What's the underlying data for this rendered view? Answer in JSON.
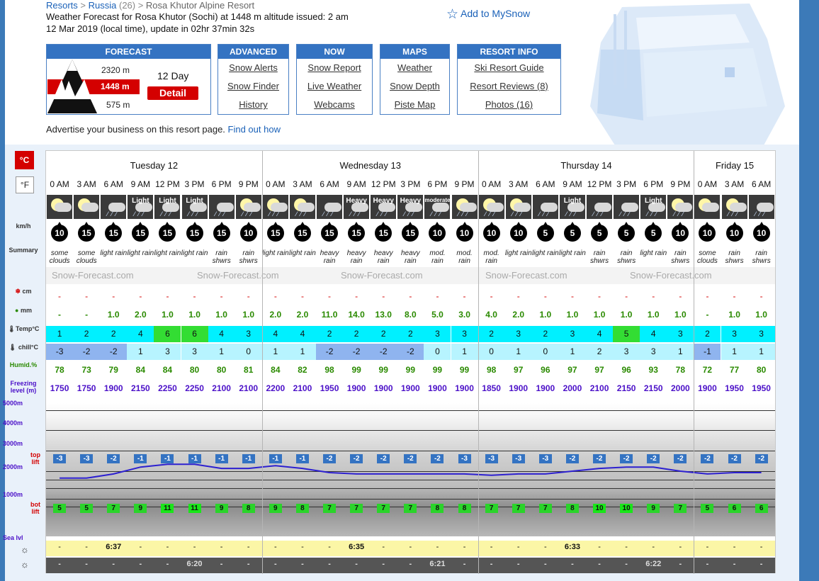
{
  "breadcrumb": {
    "resorts": "Resorts",
    "sep1": " > ",
    "country": "Russia",
    "count": " (26) > ",
    "current": "Rosa Khutor Alpine Resort"
  },
  "title": "Weather Forecast for Rosa Khutor (Sochi) at 1448 m altitude issued: 2 am\n 12 Mar 2019 (local time), update in 02hr 37min 32s",
  "mysnow": "Add to MySnow",
  "forecast_box": {
    "header": "FORECAST",
    "top_alt": "2320 m",
    "cur_alt": "1448 m",
    "bot_alt": "575 m",
    "days": "12 Day",
    "detail": "Detail"
  },
  "menus": [
    {
      "header": "ADVANCED",
      "items": [
        "Snow Alerts",
        "Snow Finder",
        "History"
      ]
    },
    {
      "header": "NOW",
      "items": [
        "Snow Report",
        "Live Weather",
        "Webcams"
      ]
    },
    {
      "header": "MAPS",
      "items": [
        "Weather",
        "Snow Depth",
        "Piste Map"
      ]
    },
    {
      "header": "RESORT INFO",
      "items": [
        "Ski Resort Guide",
        "Resort Reviews (8)",
        "Photos (16)"
      ]
    }
  ],
  "advert": {
    "text": "Advertise your business on this resort page. ",
    "link": "Find out how"
  },
  "units": {
    "c": "°C",
    "f": "°F"
  },
  "row_labels": {
    "wind": "km/h",
    "summary": "Summary",
    "snow": "cm",
    "rain": "mm",
    "temp": "Temp°C",
    "chill": "chill°C",
    "humid": "Humid.%",
    "freeze": "Freezing level (m)",
    "alt5000": "5000m",
    "alt4000": "4000m",
    "alt3000": "3000m",
    "top": "top",
    "lift": "lift",
    "alt2000": "2000m",
    "alt1000": "1000m",
    "bot": "bot",
    "lift2": "lift",
    "sealvl": "Sea lvl"
  },
  "watermark": "Snow-Forecast.com",
  "days": [
    {
      "name": "Tuesday 12",
      "n": 8
    },
    {
      "name": "Wednesday 13",
      "n": 8
    },
    {
      "name": "Thursday 14",
      "n": 8
    },
    {
      "name": "Friday 15",
      "n": 3
    }
  ],
  "columns": [
    {
      "time": "0 AM",
      "wx": "",
      "wind": "10",
      "summary": "some clouds",
      "snow": "-",
      "rain": "-",
      "temp": "1",
      "chill": "-3",
      "humid": "78",
      "freeze": "1750",
      "top": "-3",
      "bot": "5",
      "rise": "-",
      "set": "-"
    },
    {
      "time": "3 AM",
      "wx": "",
      "wind": "15",
      "summary": "some clouds",
      "snow": "-",
      "rain": "-",
      "temp": "2",
      "chill": "-2",
      "humid": "73",
      "freeze": "1750",
      "top": "-3",
      "bot": "5",
      "rise": "-",
      "set": "-"
    },
    {
      "time": "6 AM",
      "wx": "",
      "wind": "15",
      "summary": "light rain",
      "snow": "-",
      "rain": "1.0",
      "temp": "2",
      "chill": "-2",
      "humid": "79",
      "freeze": "1900",
      "top": "-2",
      "bot": "7",
      "rise": "6:37",
      "set": "-"
    },
    {
      "time": "9 AM",
      "wx": "Light",
      "wind": "15",
      "summary": "light rain",
      "snow": "-",
      "rain": "2.0",
      "temp": "4",
      "chill": "1",
      "humid": "84",
      "freeze": "2150",
      "top": "-1",
      "bot": "9",
      "rise": "-",
      "set": "-"
    },
    {
      "time": "12 PM",
      "wx": "Light",
      "wind": "15",
      "summary": "light rain",
      "snow": "-",
      "rain": "1.0",
      "temp": "6",
      "chill": "3",
      "humid": "84",
      "freeze": "2250",
      "top": "-1",
      "bot": "11",
      "rise": "-",
      "set": "-"
    },
    {
      "time": "3 PM",
      "wx": "Light",
      "wind": "15",
      "summary": "light rain",
      "snow": "-",
      "rain": "1.0",
      "temp": "6",
      "chill": "3",
      "humid": "80",
      "freeze": "2250",
      "top": "-1",
      "bot": "11",
      "rise": "-",
      "set": "6:20"
    },
    {
      "time": "6 PM",
      "wx": "",
      "wind": "15",
      "summary": "rain shwrs",
      "snow": "-",
      "rain": "1.0",
      "temp": "4",
      "chill": "1",
      "humid": "80",
      "freeze": "2100",
      "top": "-1",
      "bot": "9",
      "rise": "-",
      "set": "-"
    },
    {
      "time": "9 PM",
      "wx": "",
      "wind": "10",
      "summary": "rain shwrs",
      "snow": "-",
      "rain": "1.0",
      "temp": "3",
      "chill": "0",
      "humid": "81",
      "freeze": "2100",
      "top": "-1",
      "bot": "8",
      "rise": "-",
      "set": "-"
    },
    {
      "time": "0 AM",
      "wx": "",
      "wind": "15",
      "summary": "light rain",
      "snow": "-",
      "rain": "2.0",
      "temp": "4",
      "chill": "1",
      "humid": "84",
      "freeze": "2200",
      "top": "-1",
      "bot": "9",
      "rise": "-",
      "set": "-"
    },
    {
      "time": "3 AM",
      "wx": "",
      "wind": "15",
      "summary": "light rain",
      "snow": "-",
      "rain": "2.0",
      "temp": "4",
      "chill": "1",
      "humid": "82",
      "freeze": "2100",
      "top": "-1",
      "bot": "8",
      "rise": "-",
      "set": "-"
    },
    {
      "time": "6 AM",
      "wx": "",
      "wind": "15",
      "summary": "heavy rain",
      "snow": "-",
      "rain": "11.0",
      "temp": "2",
      "chill": "-2",
      "humid": "98",
      "freeze": "1950",
      "top": "-2",
      "bot": "7",
      "rise": "-",
      "set": "-"
    },
    {
      "time": "9 AM",
      "wx": "Heavy",
      "wind": "15",
      "summary": "heavy rain",
      "snow": "-",
      "rain": "14.0",
      "temp": "2",
      "chill": "-2",
      "humid": "99",
      "freeze": "1900",
      "top": "-2",
      "bot": "7",
      "rise": "6:35",
      "set": "-"
    },
    {
      "time": "12 PM",
      "wx": "Heavy",
      "wind": "15",
      "summary": "heavy rain",
      "snow": "-",
      "rain": "13.0",
      "temp": "2",
      "chill": "-2",
      "humid": "99",
      "freeze": "1900",
      "top": "-2",
      "bot": "7",
      "rise": "-",
      "set": "-"
    },
    {
      "time": "3 PM",
      "wx": "Heavy",
      "wind": "15",
      "summary": "heavy rain",
      "snow": "-",
      "rain": "8.0",
      "temp": "2",
      "chill": "-2",
      "humid": "99",
      "freeze": "1900",
      "top": "-2",
      "bot": "7",
      "rise": "-",
      "set": "-"
    },
    {
      "time": "6 PM",
      "wx": "moderate",
      "wind": "10",
      "summary": "mod. rain",
      "snow": "-",
      "rain": "5.0",
      "temp": "3",
      "chill": "0",
      "humid": "99",
      "freeze": "1900",
      "top": "-2",
      "bot": "8",
      "rise": "-",
      "set": "6:21"
    },
    {
      "time": "9 PM",
      "wx": "",
      "wind": "10",
      "summary": "mod. rain",
      "snow": "-",
      "rain": "3.0",
      "temp": "3",
      "chill": "1",
      "humid": "99",
      "freeze": "1900",
      "top": "-3",
      "bot": "8",
      "rise": "-",
      "set": "-"
    },
    {
      "time": "0 AM",
      "wx": "",
      "wind": "10",
      "summary": "mod. rain",
      "snow": "-",
      "rain": "4.0",
      "temp": "2",
      "chill": "0",
      "humid": "98",
      "freeze": "1850",
      "top": "-3",
      "bot": "7",
      "rise": "-",
      "set": "-"
    },
    {
      "time": "3 AM",
      "wx": "",
      "wind": "10",
      "summary": "light rain",
      "snow": "-",
      "rain": "2.0",
      "temp": "3",
      "chill": "1",
      "humid": "97",
      "freeze": "1900",
      "top": "-3",
      "bot": "7",
      "rise": "-",
      "set": "-"
    },
    {
      "time": "6 AM",
      "wx": "",
      "wind": "5",
      "summary": "light rain",
      "snow": "-",
      "rain": "1.0",
      "temp": "2",
      "chill": "0",
      "humid": "96",
      "freeze": "1900",
      "top": "-3",
      "bot": "7",
      "rise": "-",
      "set": "-"
    },
    {
      "time": "9 AM",
      "wx": "Light",
      "wind": "5",
      "summary": "light rain",
      "snow": "-",
      "rain": "1.0",
      "temp": "3",
      "chill": "1",
      "humid": "97",
      "freeze": "2000",
      "top": "-2",
      "bot": "8",
      "rise": "6:33",
      "set": "-"
    },
    {
      "time": "12 PM",
      "wx": "",
      "wind": "5",
      "summary": "rain shwrs",
      "snow": "-",
      "rain": "1.0",
      "temp": "4",
      "chill": "2",
      "humid": "97",
      "freeze": "2100",
      "top": "-2",
      "bot": "10",
      "rise": "-",
      "set": "-"
    },
    {
      "time": "3 PM",
      "wx": "",
      "wind": "5",
      "summary": "rain shwrs",
      "snow": "-",
      "rain": "1.0",
      "temp": "5",
      "chill": "3",
      "humid": "96",
      "freeze": "2150",
      "top": "-2",
      "bot": "10",
      "rise": "-",
      "set": "-"
    },
    {
      "time": "6 PM",
      "wx": "Light",
      "wind": "5",
      "summary": "light rain",
      "snow": "-",
      "rain": "1.0",
      "temp": "4",
      "chill": "3",
      "humid": "93",
      "freeze": "2150",
      "top": "-2",
      "bot": "9",
      "rise": "-",
      "set": "6:22"
    },
    {
      "time": "9 PM",
      "wx": "",
      "wind": "10",
      "summary": "rain shwrs",
      "snow": "-",
      "rain": "1.0",
      "temp": "3",
      "chill": "1",
      "humid": "78",
      "freeze": "2000",
      "top": "-2",
      "bot": "7",
      "rise": "-",
      "set": "-"
    },
    {
      "time": "0 AM",
      "wx": "",
      "wind": "10",
      "summary": "some clouds",
      "snow": "-",
      "rain": "-",
      "temp": "2",
      "chill": "-1",
      "humid": "72",
      "freeze": "1900",
      "top": "-2",
      "bot": "5",
      "rise": "-",
      "set": "-"
    },
    {
      "time": "3 AM",
      "wx": "",
      "wind": "10",
      "summary": "rain shwrs",
      "snow": "-",
      "rain": "1.0",
      "temp": "3",
      "chill": "1",
      "humid": "77",
      "freeze": "1950",
      "top": "-2",
      "bot": "6",
      "rise": "-",
      "set": "-"
    },
    {
      "time": "6 AM",
      "wx": "",
      "wind": "10",
      "summary": "rain shwrs",
      "snow": "-",
      "rain": "1.0",
      "temp": "3",
      "chill": "1",
      "humid": "80",
      "freeze": "1950",
      "top": "-2",
      "bot": "6",
      "rise": "-",
      "set": "-"
    }
  ],
  "colors": {
    "brand_blue": "#3473c2",
    "link": "#1a61b8",
    "red": "#d40000",
    "temp_cyan": "#00f0ff",
    "temp_warm": "#33dd33",
    "chill_blue": "#8fb4ef",
    "humid_green": "#2a8a00",
    "freeze_purple": "#4b10c8",
    "freeze_line": "#2d20d0"
  }
}
